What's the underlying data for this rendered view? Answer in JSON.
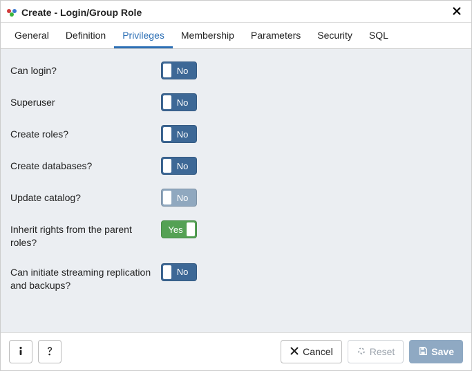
{
  "header": {
    "title": "Create - Login/Group Role"
  },
  "tabs": [
    {
      "label": "General"
    },
    {
      "label": "Definition"
    },
    {
      "label": "Privileges",
      "active": true
    },
    {
      "label": "Membership"
    },
    {
      "label": "Parameters"
    },
    {
      "label": "Security"
    },
    {
      "label": "SQL"
    }
  ],
  "privileges": {
    "rows": [
      {
        "label": "Can login?",
        "value": "No",
        "state": "no"
      },
      {
        "label": "Superuser",
        "value": "No",
        "state": "no"
      },
      {
        "label": "Create roles?",
        "value": "No",
        "state": "no"
      },
      {
        "label": "Create databases?",
        "value": "No",
        "state": "no"
      },
      {
        "label": "Update catalog?",
        "value": "No",
        "state": "no-disabled"
      },
      {
        "label": "Inherit rights from the parent roles?",
        "value": "Yes",
        "state": "yes"
      },
      {
        "label": "Can initiate streaming replication and backups?",
        "value": "No",
        "state": "no"
      }
    ]
  },
  "footer": {
    "cancel_label": "Cancel",
    "reset_label": "Reset",
    "save_label": "Save"
  }
}
